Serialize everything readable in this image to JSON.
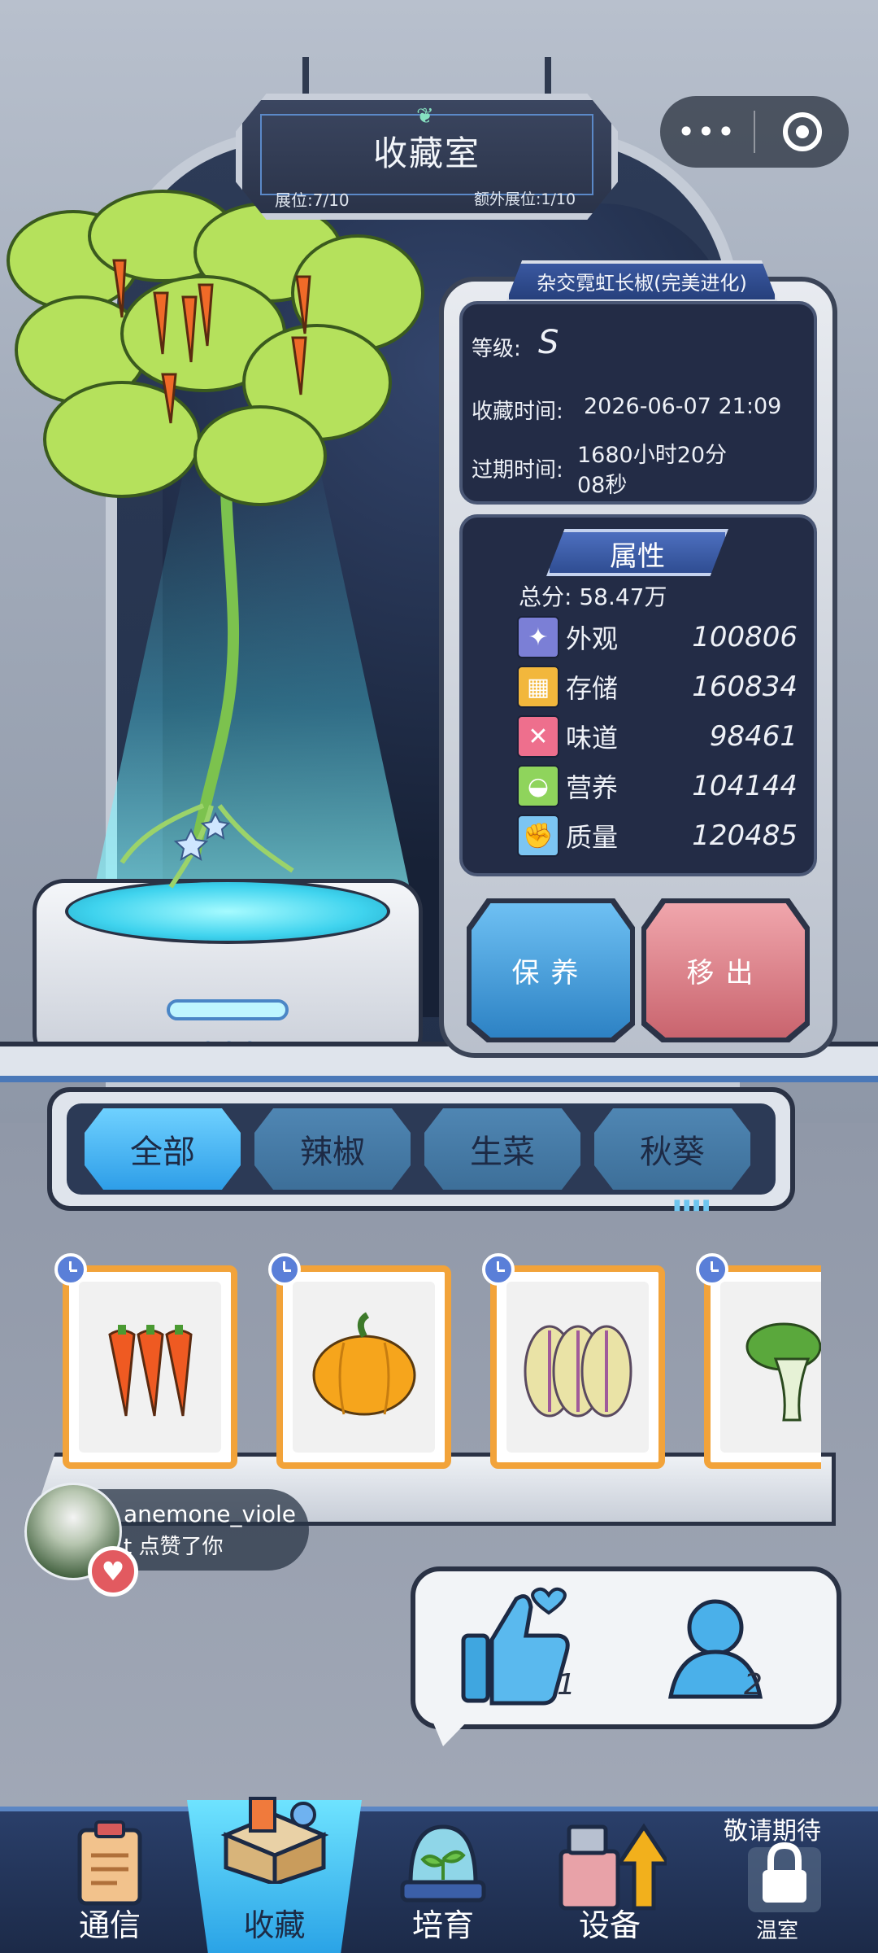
{
  "header": {
    "title": "收藏室",
    "slot_count": "展位:7/10",
    "extra_slot_count": "额外展位:1/10"
  },
  "capsule": {
    "more_icon": "more-dots-icon",
    "close_icon": "target-circle-icon"
  },
  "item": {
    "name": "杂交霓虹长椒(完美进化)",
    "grade_label": "等级:",
    "grade_value": "S",
    "collect_time_label": "收藏时间:",
    "collect_time_value": "2026-06-07 21:09",
    "expire_label": "过期时间:",
    "expire_value_line1": "1680小时20分",
    "expire_value_line2": "08秒"
  },
  "attributes": {
    "title": "属性",
    "total": "总分: 58.47万",
    "rows": [
      {
        "name": "外观",
        "value": "100806",
        "icon": "sparkle-icon",
        "color": "#7b7fd6"
      },
      {
        "name": "存储",
        "value": "160834",
        "icon": "box-icon",
        "color": "#f2b73c"
      },
      {
        "name": "味道",
        "value": "98461",
        "icon": "utensils-icon",
        "color": "#ee6f8d"
      },
      {
        "name": "营养",
        "value": "104144",
        "icon": "bowl-icon",
        "color": "#8fd45c"
      },
      {
        "name": "质量",
        "value": "120485",
        "icon": "muscle-icon",
        "color": "#7cc5f2"
      }
    ]
  },
  "actions": {
    "maintain": "保养",
    "remove": "移出"
  },
  "tabs": [
    "全部",
    "辣椒",
    "生菜",
    "秋葵"
  ],
  "cards": [
    {
      "icon": "chili-peppers-icon"
    },
    {
      "icon": "pumpkin-icon"
    },
    {
      "icon": "melon-icon"
    },
    {
      "icon": "lettuce-icon"
    }
  ],
  "notification": {
    "user": "anemone_viole",
    "action": "t 点赞了你"
  },
  "social": {
    "like_count": "1",
    "visitor_count": "2"
  },
  "nav": {
    "items": [
      "通信",
      "收藏",
      "培育",
      "设备",
      "温室"
    ],
    "coming_soon": "敬请期待"
  },
  "colors": {
    "accent": "#2e9ee8",
    "panel": "#232c46",
    "card_border": "#f2a33a"
  }
}
